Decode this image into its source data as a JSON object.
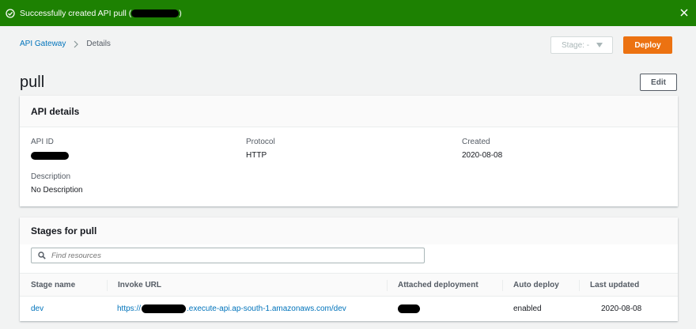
{
  "flash": {
    "message_prefix": "Successfully created API pull (",
    "message_suffix": ")",
    "status_color": "#1d8102"
  },
  "breadcrumb": {
    "root": "API Gateway",
    "current": "Details"
  },
  "header": {
    "stage_select": "Stage: -",
    "deploy_label": "Deploy",
    "title": "pull",
    "edit_label": "Edit"
  },
  "api_details": {
    "title": "API details",
    "api_id_label": "API ID",
    "protocol_label": "Protocol",
    "protocol_value": "HTTP",
    "created_label": "Created",
    "created_value": "2020-08-08",
    "description_label": "Description",
    "description_value": "No Description"
  },
  "stages": {
    "title": "Stages for pull",
    "search_placeholder": "Find resources",
    "columns": [
      "Stage name",
      "Invoke URL",
      "Attached deployment",
      "Auto deploy",
      "Last updated"
    ],
    "rows": [
      {
        "stage_name": "dev",
        "invoke_url_prefix": "https://",
        "invoke_url_suffix": ".execute-api.ap-south-1.amazonaws.com/dev",
        "auto_deploy": "enabled",
        "last_updated": "2020-08-08"
      }
    ]
  },
  "colors": {
    "accent": "#ec7211",
    "link": "#0073bb"
  }
}
